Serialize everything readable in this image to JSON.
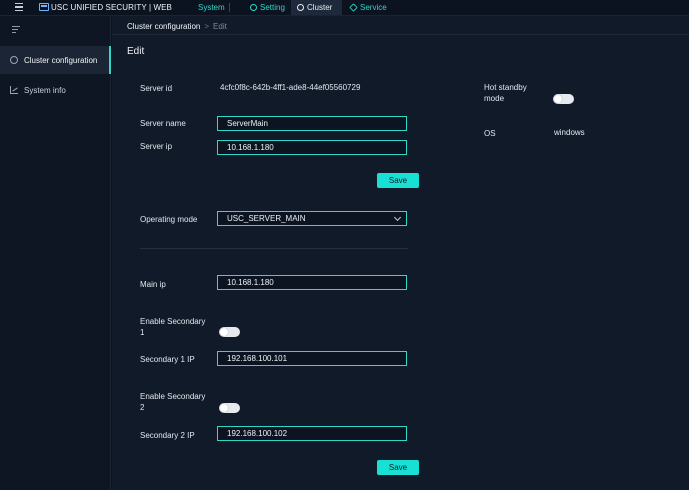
{
  "header": {
    "brand": "USC UNIFIED SECURITY | WEB",
    "nav": {
      "system": "System",
      "setting": "Setting",
      "cluster": "Cluster",
      "service": "Service"
    }
  },
  "sidebar": {
    "items": [
      {
        "label": "Cluster configuration",
        "active": true
      },
      {
        "label": "System info",
        "active": false
      }
    ]
  },
  "breadcrumb": {
    "parent": "Cluster configuration",
    "separator": ">",
    "current": "Edit"
  },
  "page_title": "Edit",
  "form": {
    "server_id": {
      "label": "Server id",
      "value": "4cfc0f8c-642b-4ff1-ade8-44ef05560729"
    },
    "server_name": {
      "label": "Server name",
      "value": "ServerMain"
    },
    "server_ip": {
      "label": "Server ip",
      "value": "10.168.1.180"
    },
    "save_label": "Save",
    "operating_mode": {
      "label": "Operating mode",
      "value": "USC_SERVER_MAIN"
    },
    "main_ip": {
      "label": "Main ip",
      "value": "10.168.1.180"
    },
    "enable_secondary_1": {
      "label_line1": "Enable Secondary",
      "label_line2": "1",
      "on": false
    },
    "secondary_1_ip": {
      "label": "Secondary 1 IP",
      "value": "192.168.100.101"
    },
    "enable_secondary_2": {
      "label_line1": "Enable Secondary",
      "label_line2": "2",
      "on": false
    },
    "secondary_2_ip": {
      "label": "Secondary 2 IP",
      "value": "192.168.100.102"
    },
    "save_label_2": "Save"
  },
  "info": {
    "hot_standby": {
      "label_line1": "Hot standby",
      "label_line2": "mode",
      "on": false
    },
    "os": {
      "label": "OS",
      "value": "windows"
    }
  },
  "colors": {
    "accent": "#19e0d4",
    "nav_accent": "#2fd8c8",
    "background": "#111a29"
  }
}
